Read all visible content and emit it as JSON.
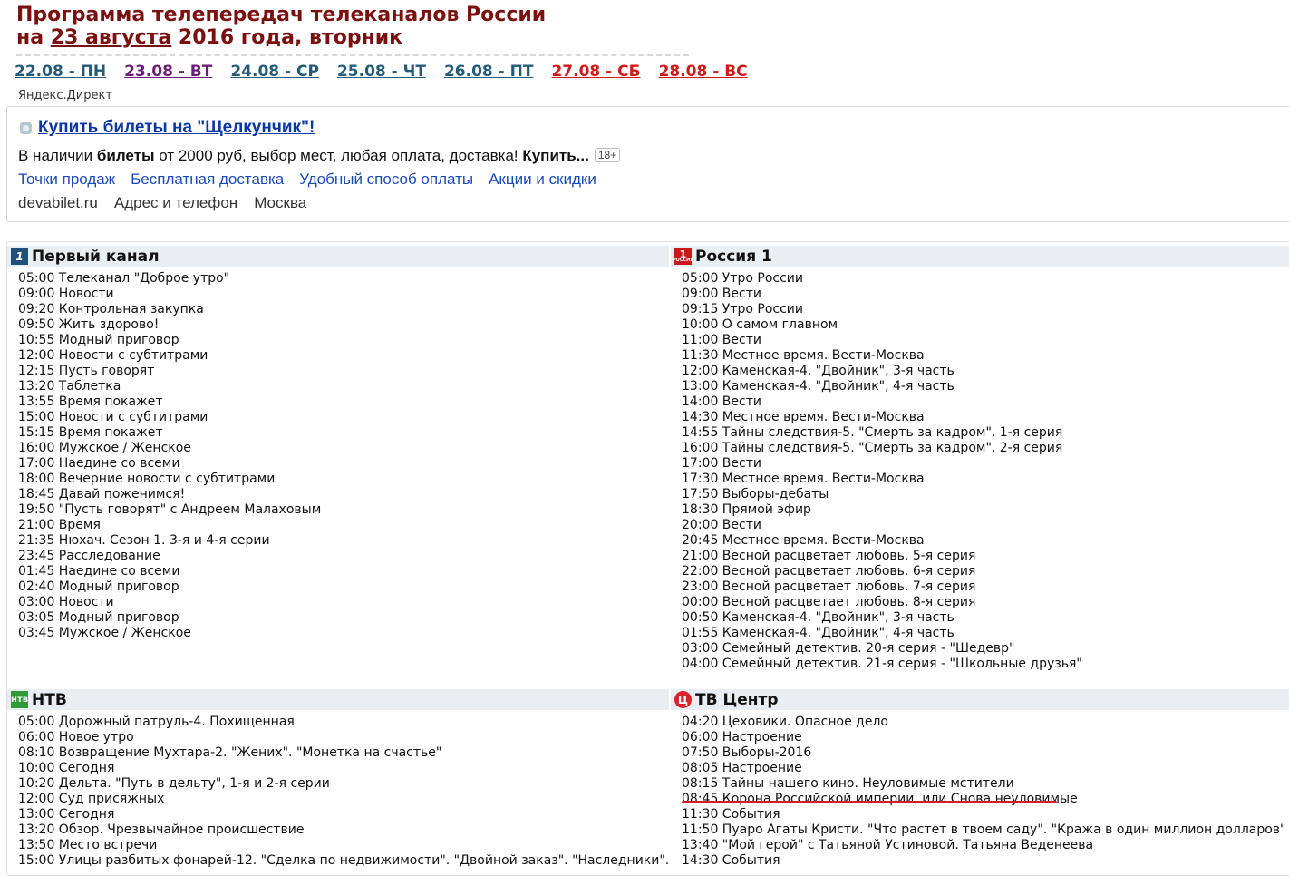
{
  "header": {
    "title_line1": "Программа телепередач телеканалов России",
    "title_prefix": "на",
    "title_date": "23 августа",
    "title_suffix": "2016 года, вторник"
  },
  "days": [
    {
      "label": "22.08 - ПН",
      "kind": "weekday"
    },
    {
      "label": "23.08 - ВТ",
      "kind": "current"
    },
    {
      "label": "24.08 - СР",
      "kind": "weekday"
    },
    {
      "label": "25.08 - ЧТ",
      "kind": "weekday"
    },
    {
      "label": "26.08 - ПТ",
      "kind": "weekday"
    },
    {
      "label": "27.08 - СБ",
      "kind": "weekend"
    },
    {
      "label": "28.08 - ВС",
      "kind": "weekend"
    }
  ],
  "ad": {
    "provider_label": "Яндекс.Директ",
    "title": "Купить билеты на \"Щелкунчик\"!",
    "body_part1": "В наличии ",
    "body_bold1": "билеты",
    "body_part2": " от 2000 руб, выбор мест, любая оплата, доставка! ",
    "body_bold2": "Купить...",
    "age": "18+",
    "links": [
      "Точки продаж",
      "Бесплатная доставка",
      "Удобный способ оплаты",
      "Акции и скидки"
    ],
    "meta": [
      "devabilet.ru",
      "Адрес и телефон",
      "Москва"
    ]
  },
  "channels": {
    "perviy": {
      "name": "Первый канал",
      "logo": "1",
      "programs": [
        "05:00 Телеканал \"Доброе утро\"",
        "09:00 Новости",
        "09:20 Контрольная закупка",
        "09:50 Жить здорово!",
        "10:55 Модный приговор",
        "12:00 Новости с субтитрами",
        "12:15 Пусть говорят",
        "13:20 Таблетка",
        "13:55 Время покажет",
        "15:00 Новости с субтитрами",
        "15:15 Время покажет",
        "16:00 Мужское / Женское",
        "17:00 Наедине со всеми",
        "18:00 Вечерние новости с субтитрами",
        "18:45 Давай поженимся!",
        "19:50 \"Пусть говорят\" с Андреем Малаховым",
        "21:00 Время",
        "21:35 Нюхач. Сезон 1. 3-я и 4-я серии",
        "23:45 Расследование",
        "01:45 Наедине со всеми",
        "02:40 Модный приговор",
        "03:00 Новости",
        "03:05 Модный приговор",
        "03:45 Мужское / Женское"
      ]
    },
    "russia1": {
      "name": "Россия 1",
      "logo": "1",
      "programs": [
        "05:00 Утро России",
        "09:00 Вести",
        "09:15 Утро России",
        "10:00 О самом главном",
        "11:00 Вести",
        "11:30 Местное время. Вести-Москва",
        "12:00 Каменская-4. \"Двойник\", 3-я часть",
        "13:00 Каменская-4. \"Двойник\", 4-я часть",
        "14:00 Вести",
        "14:30 Местное время. Вести-Москва",
        "14:55 Тайны следствия-5. \"Смерть за кадром\", 1-я серия",
        "16:00 Тайны следствия-5. \"Смерть за кадром\", 2-я серия",
        "17:00 Вести",
        "17:30 Местное время. Вести-Москва",
        "17:50 Выборы-дебаты",
        "18:30 Прямой эфир",
        "20:00 Вести",
        "20:45 Местное время. Вести-Москва",
        "21:00 Весной расцветает любовь. 5-я серия",
        "22:00 Весной расцветает любовь. 6-я серия",
        "23:00 Весной расцветает любовь. 7-я серия",
        "00:00 Весной расцветает любовь. 8-я серия",
        "00:50 Каменская-4. \"Двойник\", 3-я часть",
        "01:55 Каменская-4. \"Двойник\", 4-я часть",
        "03:00 Семейный детектив. 20-я серия - \"Шедевр\"",
        "04:00 Семейный детектив. 21-я серия - \"Школьные друзья\""
      ]
    },
    "ntv": {
      "name": "НТВ",
      "logo": "нтв",
      "programs": [
        "05:00 Дорожный патруль-4. Похищенная",
        "06:00 Новое утро",
        "08:10 Возвращение Мухтара-2. \"Жених\". \"Монетка на счастье\"",
        "10:00 Сегодня",
        "10:20 Дельта. \"Путь в дельту\", 1-я и 2-я серии",
        "12:00 Суд присяжных",
        "13:00 Сегодня",
        "13:20 Обзор. Чрезвычайное происшествие",
        "13:50 Место встречи",
        "15:00 Улицы разбитых фонарей-12. \"Сделка по недвижимости\". \"Двойной заказ\". \"Наследники\"."
      ]
    },
    "tvc": {
      "name": "ТВ Центр",
      "logo": "Ц",
      "programs": [
        "04:20 Цеховики. Опасное дело",
        "06:00 Настроение",
        "07:50 Выборы-2016",
        "08:05 Настроение",
        "08:15 Тайны нашего кино. Неуловимые мстители",
        "08:45 Корона Российской империи, или Снова неуловимые",
        "11:30 События",
        "11:50 Пуаро Агаты Кристи. \"Что растет в твоем саду\". \"Кража в один миллион долларов\"",
        "13:40 \"Мой герой\" с Татьяной Устиновой. Татьяна Веденеева",
        "14:30 События"
      ]
    }
  },
  "colors": {
    "title": "#7a1010",
    "weekday_link": "#245b7a",
    "current_link": "#6a1e77",
    "weekend_link": "#d21a1a",
    "ad_link": "#1d49b8",
    "highlight_underline": "#d01f2a"
  }
}
